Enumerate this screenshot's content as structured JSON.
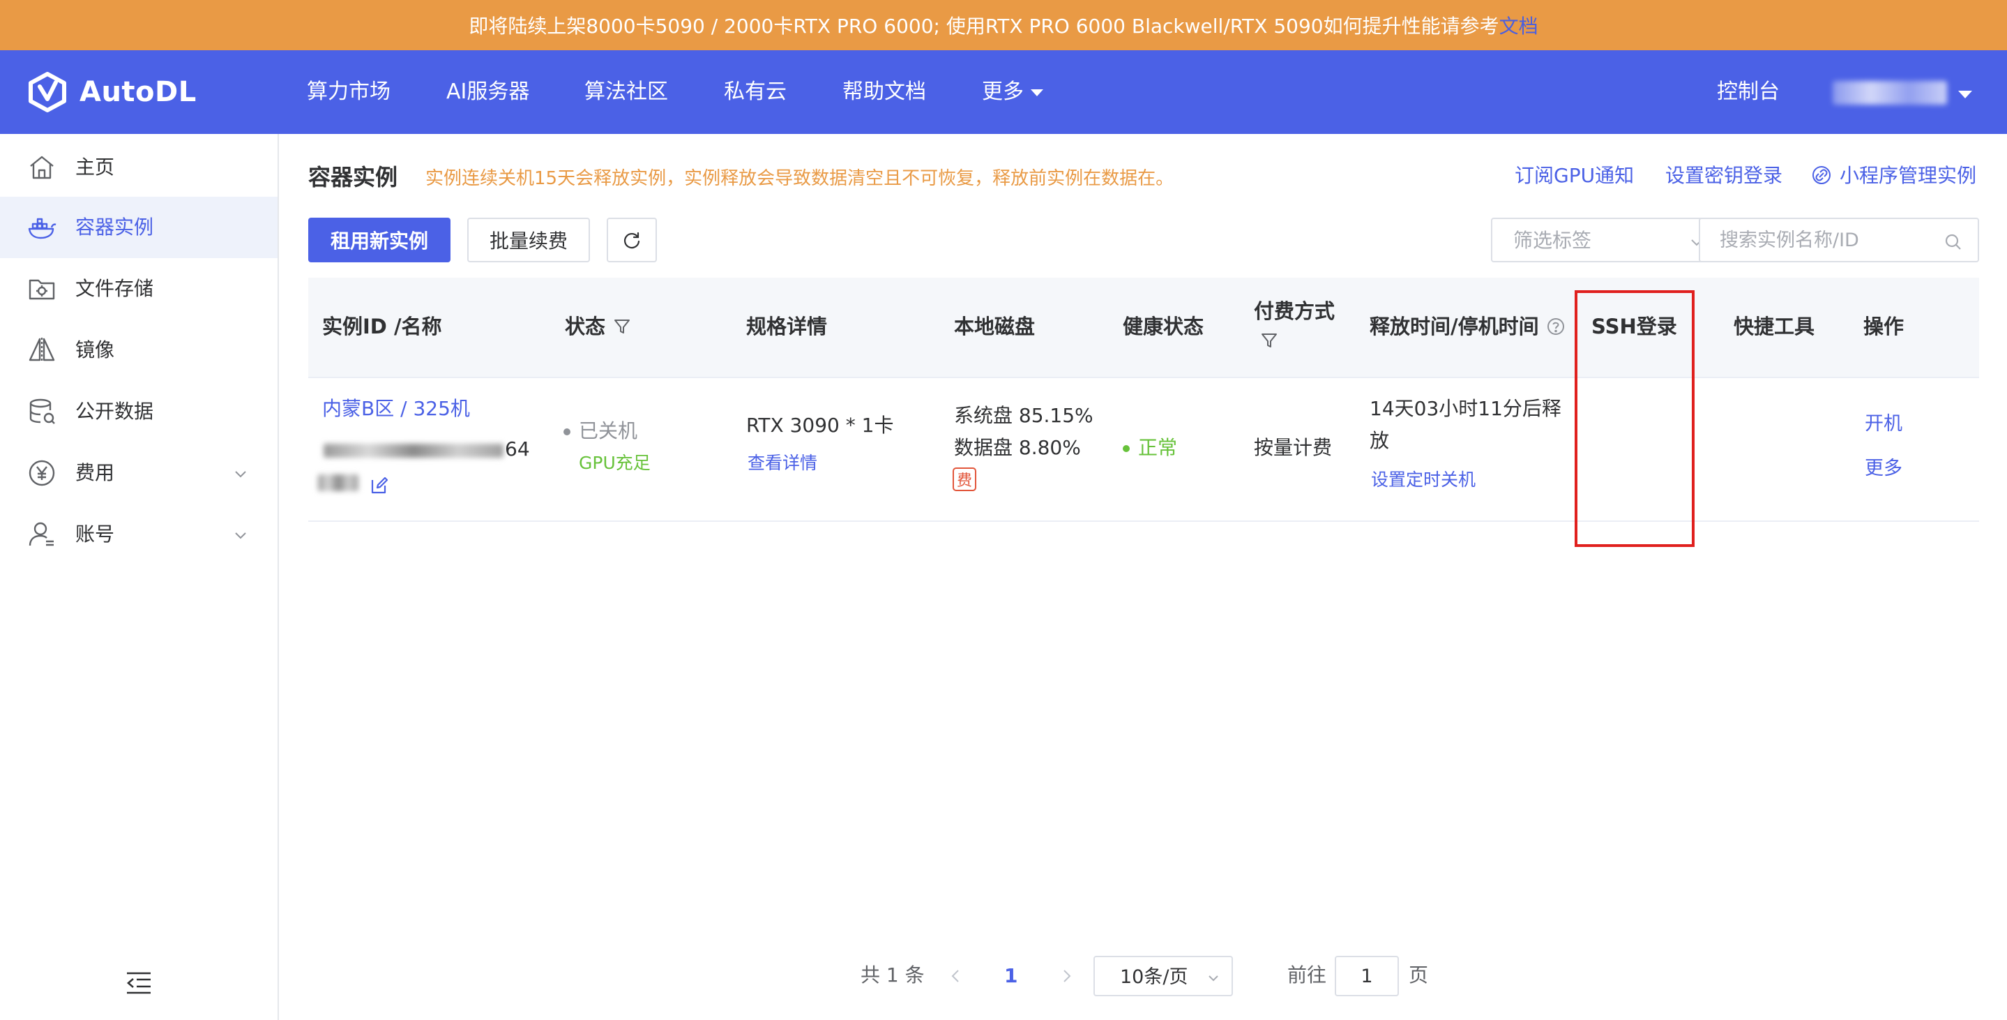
{
  "banner": {
    "text": "即将陆续上架8000卡5090 / 2000卡RTX PRO 6000; 使用RTX PRO 6000 Blackwell/RTX 5090如何提升性能请参考",
    "link": "文档"
  },
  "brand": {
    "name": "AutoDL"
  },
  "nav": {
    "items": [
      "算力市场",
      "AI服务器",
      "算法社区",
      "私有云",
      "帮助文档",
      "更多"
    ],
    "console": "控制台"
  },
  "sidebar": {
    "items": [
      {
        "label": "主页",
        "icon": "home-icon"
      },
      {
        "label": "容器实例",
        "icon": "container-icon",
        "active": true
      },
      {
        "label": "文件存储",
        "icon": "folder-icon"
      },
      {
        "label": "镜像",
        "icon": "mirror-icon"
      },
      {
        "label": "公开数据",
        "icon": "database-icon"
      },
      {
        "label": "费用",
        "icon": "yuan-icon",
        "expandable": true
      },
      {
        "label": "账号",
        "icon": "user-icon",
        "expandable": true
      }
    ]
  },
  "main": {
    "title": "容器实例",
    "warning": "实例连续关机15天会释放实例，实例释放会导致数据清空且不可恢复，释放前实例在数据在。",
    "links": {
      "subscribe": "订阅GPU通知",
      "key_login": "设置密钥登录",
      "miniprogram": "小程序管理实例"
    },
    "buttons": {
      "rent": "租用新实例",
      "renew": "批量续费"
    },
    "filter_placeholder": "筛选标签",
    "search_placeholder": "搜索实例名称/ID"
  },
  "table": {
    "headers": {
      "id": "实例ID /名称",
      "status": "状态",
      "spec": "规格详情",
      "disk": "本地磁盘",
      "health": "健康状态",
      "billing": "付费方式",
      "release": "释放时间/停机时间",
      "ssh": "SSH登录",
      "tools": "快捷工具",
      "actions": "操作"
    },
    "rows": [
      {
        "name": "内蒙B区 / 325机",
        "id_suffix": "64",
        "status": "已关机",
        "gpu_status": "GPU充足",
        "spec": "RTX 3090 * 1卡",
        "spec_link": "查看详情",
        "system_disk": "系统盘 85.15%",
        "data_disk": "数据盘 8.80%",
        "fee_badge": "费",
        "health": "正常",
        "billing": "按量计费",
        "release_line1": "14天03小时11分后释",
        "release_line2": "放",
        "shutdown_link": "设置定时关机",
        "action_start": "开机",
        "action_more": "更多"
      }
    ]
  },
  "pagination": {
    "total": "共 1 条",
    "current": "1",
    "page_size": "10条/页",
    "goto_label": "前往",
    "goto_value": "1",
    "page_unit": "页"
  },
  "colors": {
    "banner": "#e99a45",
    "primary": "#4b61e6",
    "warning": "#e99a45",
    "success": "#67c23a",
    "highlight": "#e0201e"
  }
}
